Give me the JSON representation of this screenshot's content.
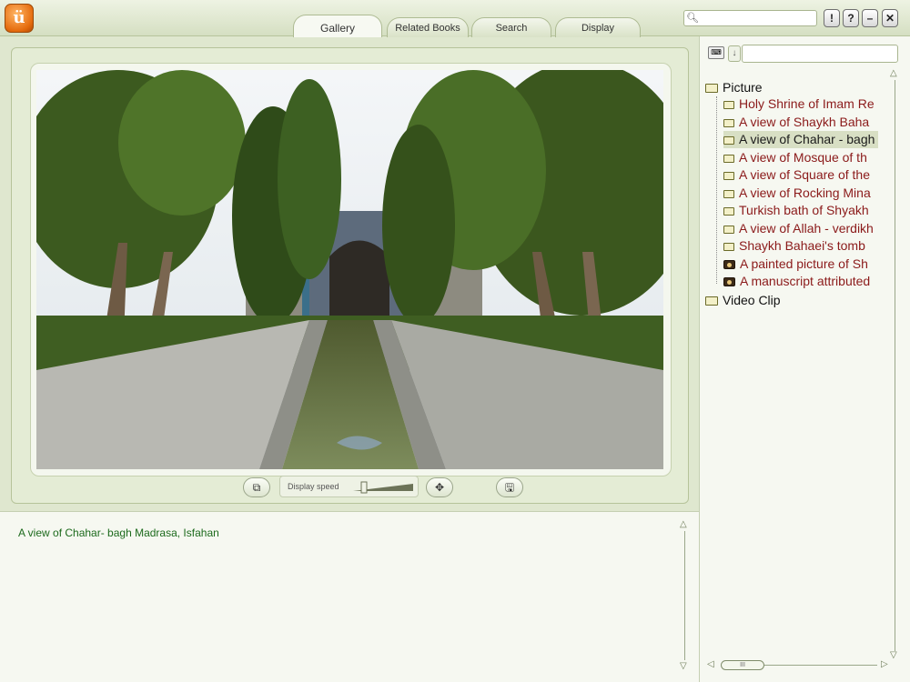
{
  "app": {
    "logo_glyph": "ü"
  },
  "tabs": [
    {
      "label": "Gallery",
      "active": true
    },
    {
      "label": "Related Books",
      "active": false
    },
    {
      "label": "Search",
      "active": false
    },
    {
      "label": "Display",
      "active": false
    }
  ],
  "search": {
    "value": "",
    "placeholder": ""
  },
  "window_buttons": {
    "info": "!",
    "help": "?",
    "minimize": "–",
    "close": "✕"
  },
  "viewer": {
    "display_speed_label": "Display speed",
    "speed_level": 0.15
  },
  "caption": "A view of Chahar- bagh Madrasa, Isfahan",
  "tree": {
    "search_value": "",
    "root_picture": "Picture",
    "root_video": "Video Clip",
    "items": [
      {
        "label": "Holy Shrine of Imam Re",
        "icon": "folder-icon",
        "selected": false
      },
      {
        "label": "A view of Shaykh Baha",
        "icon": "folder-icon",
        "selected": false
      },
      {
        "label": "A view of Chahar - bagh",
        "icon": "folder-icon",
        "selected": true
      },
      {
        "label": "A view of Mosque of th",
        "icon": "folder-icon",
        "selected": false
      },
      {
        "label": "A view of Square of the",
        "icon": "folder-icon",
        "selected": false
      },
      {
        "label": "A view of Rocking Mina",
        "icon": "folder-icon",
        "selected": false
      },
      {
        "label": "Turkish bath of Shyakh",
        "icon": "folder-icon",
        "selected": false
      },
      {
        "label": "A view of Allah - verdikh",
        "icon": "folder-icon",
        "selected": false
      },
      {
        "label": "Shaykh Bahaei's tomb",
        "icon": "folder-icon",
        "selected": false
      },
      {
        "label": "A painted picture of Sh",
        "icon": "camera-icon",
        "selected": false
      },
      {
        "label": "A manuscript attributed",
        "icon": "camera-icon",
        "selected": false
      }
    ]
  },
  "colors": {
    "accent_green": "#1c6a1c",
    "tree_text": "#8b1a1a",
    "panel_bg": "#e4ecd5"
  }
}
